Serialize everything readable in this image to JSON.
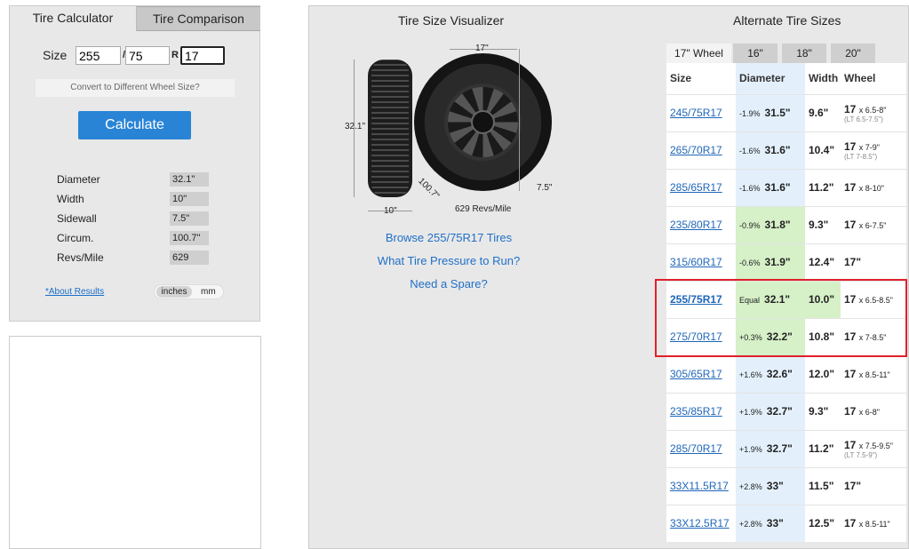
{
  "calculator": {
    "tabs": [
      "Tire Calculator",
      "Tire Comparison"
    ],
    "size_label": "Size",
    "width": "255",
    "aspect": "75",
    "rim_label": "R",
    "rim": "17",
    "separator": "/",
    "convert_label": "Convert to Different Wheel Size?",
    "calculate_label": "Calculate",
    "results": [
      {
        "label": "Diameter",
        "value": "32.1\""
      },
      {
        "label": "Width",
        "value": "10\""
      },
      {
        "label": "Sidewall",
        "value": "7.5\""
      },
      {
        "label": "Circum.",
        "value": "100.7\""
      },
      {
        "label": "Revs/Mile",
        "value": "629"
      }
    ],
    "about_label": "*About Results",
    "unit_inches": "inches",
    "unit_mm": "mm"
  },
  "visualizer": {
    "title": "Tire Size Visualizer",
    "dim_height": "32.1\"",
    "dim_width": "10\"",
    "dim_rim": "17\"",
    "dim_sidewall": "7.5\"",
    "dim_circ": "100.7\"",
    "revs": "629 Revs/Mile",
    "links": [
      "Browse 255/75R17 Tires",
      "What Tire Pressure to Run?",
      "Need a Spare?"
    ]
  },
  "alternate": {
    "title": "Alternate Tire Sizes",
    "wheel_tabs": [
      "17\" Wheel",
      "16\"",
      "18\"",
      "20\""
    ],
    "headers": [
      "Size",
      "Diameter",
      "Width",
      "Wheel"
    ],
    "rows": [
      {
        "size": "245/75R17",
        "pct": "-1.9%",
        "diam": "31.5\"",
        "width": "9.6\"",
        "wheel": "17",
        "wheel_sub": "x 6.5-8\"",
        "lt": "(LT 6.5-7.5\")"
      },
      {
        "size": "265/70R17",
        "pct": "-1.6%",
        "diam": "31.6\"",
        "width": "10.4\"",
        "wheel": "17",
        "wheel_sub": "x 7-9\"",
        "lt": "(LT 7-8.5\")"
      },
      {
        "size": "285/65R17",
        "pct": "-1.6%",
        "diam": "31.6\"",
        "width": "11.2\"",
        "wheel": "17",
        "wheel_sub": "x 8-10\"",
        "lt": ""
      },
      {
        "size": "235/80R17",
        "pct": "-0.9%",
        "diam": "31.8\"",
        "width": "9.3\"",
        "wheel": "17",
        "wheel_sub": "x 6-7.5\"",
        "lt": ""
      },
      {
        "size": "315/60R17",
        "pct": "-0.6%",
        "diam": "31.9\"",
        "width": "12.4\"",
        "wheel": "17\"",
        "wheel_sub": "",
        "lt": ""
      },
      {
        "size": "255/75R17",
        "pct": "Equal",
        "diam": "32.1\"",
        "width": "10.0\"",
        "wheel": "17",
        "wheel_sub": "x 6.5-8.5\"",
        "lt": ""
      },
      {
        "size": "275/70R17",
        "pct": "+0.3%",
        "diam": "32.2\"",
        "width": "10.8\"",
        "wheel": "17",
        "wheel_sub": "x 7-8.5\"",
        "lt": ""
      },
      {
        "size": "305/65R17",
        "pct": "+1.6%",
        "diam": "32.6\"",
        "width": "12.0\"",
        "wheel": "17",
        "wheel_sub": "x 8.5-11\"",
        "lt": ""
      },
      {
        "size": "235/85R17",
        "pct": "+1.9%",
        "diam": "32.7\"",
        "width": "9.3\"",
        "wheel": "17",
        "wheel_sub": "x 6-8\"",
        "lt": ""
      },
      {
        "size": "285/70R17",
        "pct": "+1.9%",
        "diam": "32.7\"",
        "width": "11.2\"",
        "wheel": "17",
        "wheel_sub": "x 7.5-9.5\"",
        "lt": "(LT 7.5-9\")"
      },
      {
        "size": "33X11.5R17",
        "pct": "+2.8%",
        "diam": "33\"",
        "width": "11.5\"",
        "wheel": "17\"",
        "wheel_sub": "",
        "lt": ""
      },
      {
        "size": "33X12.5R17",
        "pct": "+2.8%",
        "diam": "33\"",
        "width": "12.5\"",
        "wheel": "17",
        "wheel_sub": "x 8.5-11\"",
        "lt": ""
      }
    ]
  }
}
